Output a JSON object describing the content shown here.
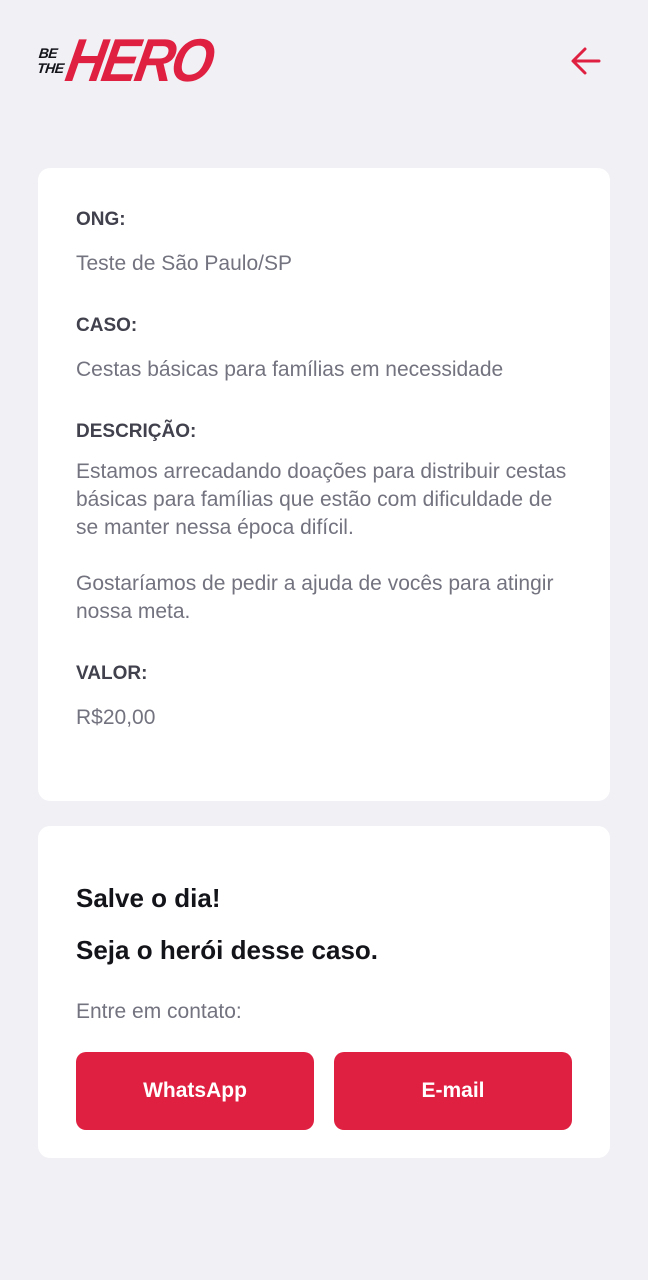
{
  "header": {
    "logo_top": "BE",
    "logo_middle": "THE",
    "logo_main": "HERO",
    "back_icon": "arrow-left-icon",
    "accent_color": "#e02041"
  },
  "incident": {
    "ong_label": "ONG:",
    "ong_value": "Teste de São Paulo/SP",
    "case_label": "CASO:",
    "case_value": "Cestas básicas para famílias em necessidade",
    "description_label": "DESCRIÇÃO:",
    "description_p1": "Estamos arrecadando doações para distribuir cestas básicas para famílias que estão com dificuldade de se manter nessa época difícil.",
    "description_p2": "Gostaríamos de pedir a ajuda de vocês para atingir nossa meta.",
    "value_label": "VALOR:",
    "value_value": "R$20,00"
  },
  "contact": {
    "title_line1": "Salve o dia!",
    "title_line2": "Seja o herói desse caso.",
    "subtitle": "Entre em contato:",
    "whatsapp_label": "WhatsApp",
    "email_label": "E-mail"
  }
}
